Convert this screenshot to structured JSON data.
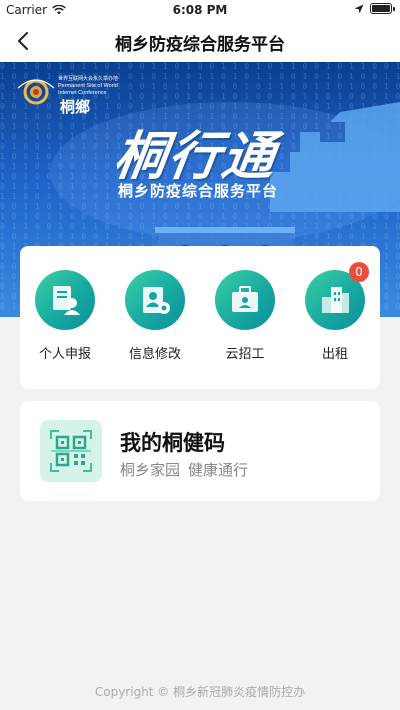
{
  "status_bar": {
    "carrier": "Carrier",
    "time": "6:08 PM"
  },
  "nav": {
    "title": "桐乡防疫综合服务平台",
    "back_icon": "chevron-left-icon"
  },
  "banner": {
    "logo_cn": "世界互联网大会永久举办地",
    "logo_en_line1": "Permanent Site of World",
    "logo_en_line2": "Internet Conference",
    "brand": "桐鄉",
    "calligraphy": "桐行通",
    "subtitle": "桐乡防疫综合服务平台",
    "colors": {
      "top": "#0b3f8f",
      "bottom": "#3b8ae0"
    }
  },
  "services": [
    {
      "label": "个人申报",
      "icon": "personal-declaration-icon"
    },
    {
      "label": "信息修改",
      "icon": "info-edit-icon"
    },
    {
      "label": "云招工",
      "icon": "cloud-recruit-icon"
    },
    {
      "label": "出租",
      "icon": "rental-building-icon",
      "badge": "0"
    }
  ],
  "health_code": {
    "title": "我的桐健码",
    "subtitle_left": "桐乡家园",
    "subtitle_right": "健康通行",
    "icon": "qr-code-icon"
  },
  "footer": {
    "text": "Copyright © 桐乡新冠肺炎疫情防控办"
  },
  "colors": {
    "accent_teal": "#16a6a0",
    "badge_red": "#ef4c3f"
  }
}
